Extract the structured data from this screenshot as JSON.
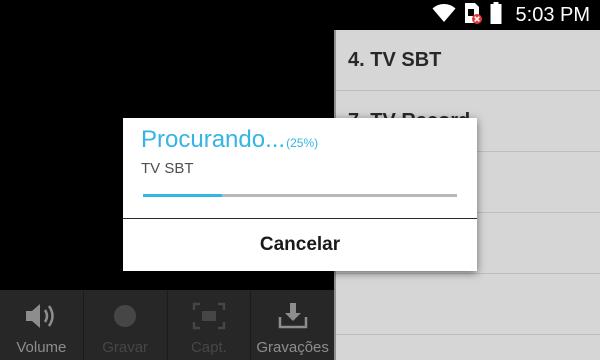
{
  "status_bar": {
    "time": "5:03 PM",
    "icons": [
      "wifi-icon",
      "sim-error-icon",
      "battery-icon"
    ]
  },
  "channel_list": {
    "items": [
      {
        "label": "4. TV SBT"
      },
      {
        "label": "7. TV Record"
      },
      {
        "label": ""
      },
      {
        "label": ""
      },
      {
        "label": ""
      }
    ]
  },
  "toolbar": {
    "volume_label": "Volume",
    "record_label": "Gravar",
    "capture_label": "Capt.",
    "recordings_label": "Gravações"
  },
  "dialog": {
    "title": "Procurando...",
    "percent_text": "(25%)",
    "progress": 0.25,
    "subtitle": "TV SBT",
    "cancel_label": "Cancelar"
  },
  "colors": {
    "accent": "#33b5e5",
    "list_bg": "#e9e9e9",
    "toolbar_bg": "#2b2b2b"
  }
}
